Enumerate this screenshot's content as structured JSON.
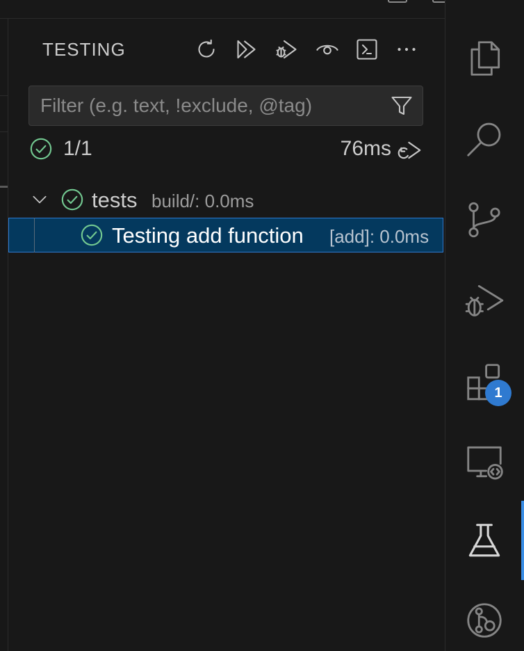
{
  "panel": {
    "title": "TESTING",
    "toolbar_icons": [
      "refresh-icon",
      "run-all-icon",
      "debug-all-icon",
      "eye-icon",
      "terminal-icon",
      "more-icon"
    ]
  },
  "filter": {
    "placeholder": "Filter (e.g. text, !exclude, @tag)",
    "value": "",
    "icon": "filter-icon"
  },
  "summary": {
    "count": "1/1",
    "duration": "76ms",
    "rerun_icon": "rerun-icon"
  },
  "tree": [
    {
      "label": "tests",
      "description": "build/: 0.0ms",
      "status": "passed",
      "expanded": true
    },
    {
      "label": "Testing add function",
      "description": "[add]: 0.0ms",
      "status": "passed",
      "selected": true
    }
  ],
  "activity_bar": {
    "items": [
      "explorer-icon",
      "search-icon",
      "source-control-icon",
      "run-debug-icon",
      "extensions-icon",
      "remote-explorer-icon",
      "testing-icon",
      "gitlens-icon"
    ],
    "active": "testing-icon",
    "extensions_badge": "1"
  },
  "colors": {
    "background": "#181818",
    "pass": "#73c991",
    "selection": "#04395e",
    "accent": "#3a8ee6"
  }
}
